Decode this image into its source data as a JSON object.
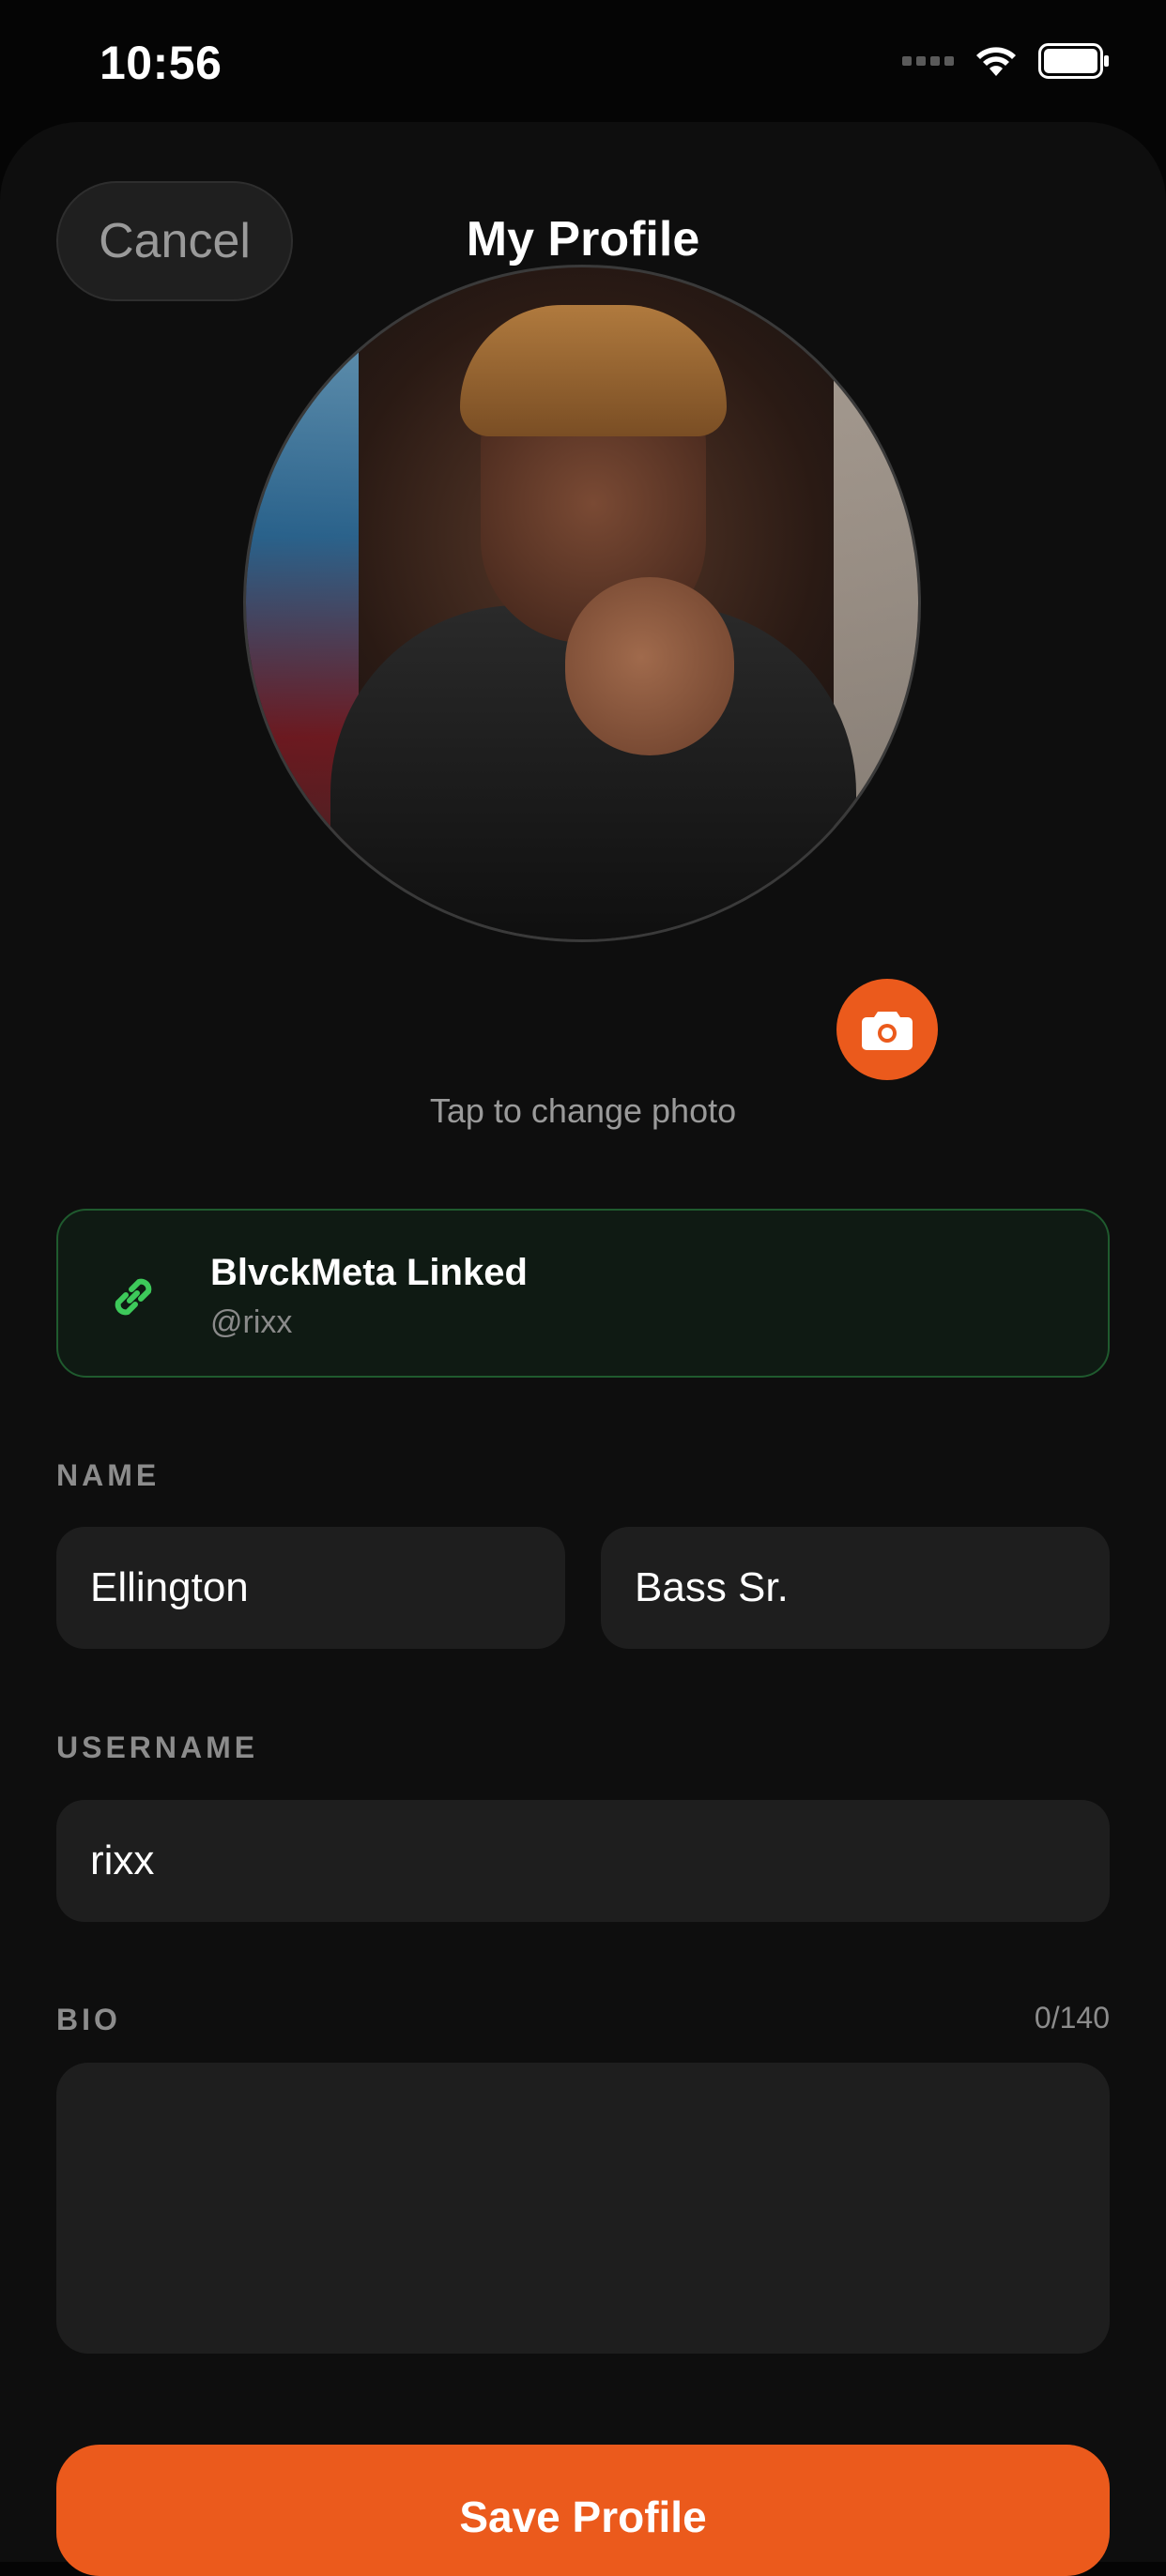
{
  "status_bar": {
    "time": "10:56"
  },
  "header": {
    "cancel_label": "Cancel",
    "title": "My Profile"
  },
  "profile_photo": {
    "hint": "Tap to change photo"
  },
  "linked_account": {
    "title": "BlvckMeta Linked",
    "handle": "@rixx",
    "accent": "#3dc95a"
  },
  "name_section": {
    "label": "NAME",
    "first_name": "Ellington",
    "last_name": "Bass Sr."
  },
  "username_section": {
    "label": "USERNAME",
    "value": "rixx"
  },
  "bio_section": {
    "label": "BIO",
    "counter": "0/140",
    "value": ""
  },
  "save_button": {
    "label": "Save Profile"
  },
  "colors": {
    "accent": "#eb5a1c",
    "background": "#0e0e0e",
    "field": "#1e1e1e"
  },
  "icons": [
    "wifi-icon",
    "battery-icon",
    "camera-icon",
    "link-icon"
  ]
}
